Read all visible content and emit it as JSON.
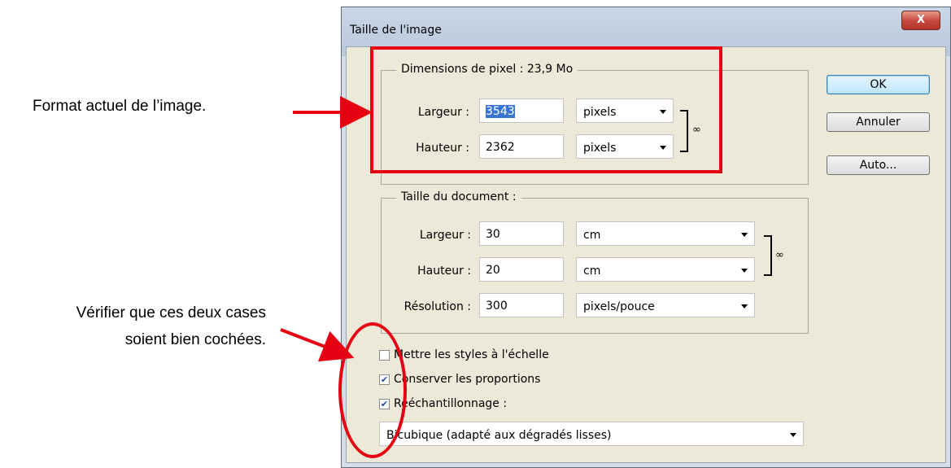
{
  "annotations": {
    "format_text": "Format actuel de l’image.",
    "check_line1": "Vérifier que ces deux cases",
    "check_line2": "soient bien cochées."
  },
  "dialog": {
    "title": "Taille de l'image",
    "close_label": "X",
    "pixel_dimensions": {
      "legend": "Dimensions de pixel :  23,9 Mo",
      "width_label": "Largeur :",
      "width_value": "3543",
      "width_unit": "pixels",
      "height_label": "Hauteur :",
      "height_value": "2362",
      "height_unit": "pixels"
    },
    "document_size": {
      "legend": "Taille du document :",
      "width_label": "Largeur :",
      "width_value": "30",
      "width_unit": "cm",
      "height_label": "Hauteur :",
      "height_value": "20",
      "height_unit": "cm",
      "resolution_label": "Résolution :",
      "resolution_value": "300",
      "resolution_unit": "pixels/pouce"
    },
    "buttons": {
      "ok": "OK",
      "cancel": "Annuler",
      "auto": "Auto..."
    },
    "checkboxes": {
      "scale_styles": {
        "label": "Mettre les styles à l'échelle",
        "checked": false
      },
      "constrain": {
        "label": "Conserver les proportions",
        "checked": true
      },
      "resample": {
        "label": "Rééchantillonnage :",
        "checked": true
      }
    },
    "resample_method": "Bicubique (adapté aux dégradés lisses)"
  },
  "colors": {
    "annotation_red": "#e60012",
    "selection_blue": "#3875d7"
  }
}
